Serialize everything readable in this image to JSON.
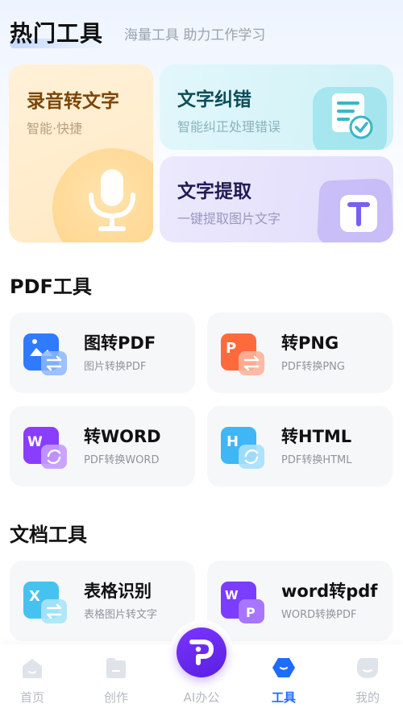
{
  "header": {
    "title": "热门工具",
    "subtitle": "海量工具 助力工作学习"
  },
  "hot_tools": {
    "audio": {
      "title": "录音转文字",
      "subtitle": "智能·快捷",
      "icon": "microphone-icon"
    },
    "correct": {
      "title": "文字纠错",
      "subtitle": "智能纠正处理错误",
      "icon": "document-check-icon"
    },
    "extract": {
      "title": "文字提取",
      "subtitle": "一键提取图片文字",
      "icon": "text-t-icon"
    }
  },
  "pdf_section": {
    "title": "PDF工具",
    "tiles": [
      {
        "title": "图转PDF",
        "subtitle": "图片转换PDF",
        "icon": "image-convert-icon",
        "color": "#2f7bff"
      },
      {
        "title": "转PNG",
        "subtitle": "PDF转换PNG",
        "icon": "png-convert-icon",
        "color": "#ff6a3d"
      },
      {
        "title": "转WORD",
        "subtitle": "PDF转换WORD",
        "icon": "word-convert-icon",
        "color": "#8a3dff"
      },
      {
        "title": "转HTML",
        "subtitle": "PDF转换HTML",
        "icon": "html-convert-icon",
        "color": "#3fb6f5"
      }
    ]
  },
  "doc_section": {
    "title": "文档工具",
    "tiles": [
      {
        "title": "表格识别",
        "subtitle": "表格图片转文字",
        "icon": "excel-convert-icon",
        "color": "#46c2f0"
      },
      {
        "title": "word转pdf",
        "subtitle": "WORD转换PDF",
        "icon": "word-to-pdf-icon",
        "color": "#7b3dff"
      }
    ]
  },
  "bottom_nav": {
    "items": [
      {
        "label": "首页",
        "icon": "home-icon"
      },
      {
        "label": "创作",
        "icon": "create-icon"
      },
      {
        "label": "AI办公",
        "icon": "ai-office-icon"
      },
      {
        "label": "工具",
        "icon": "tools-icon",
        "active": true
      },
      {
        "label": "我的",
        "icon": "profile-icon"
      }
    ],
    "accent": "#1f6bff"
  }
}
